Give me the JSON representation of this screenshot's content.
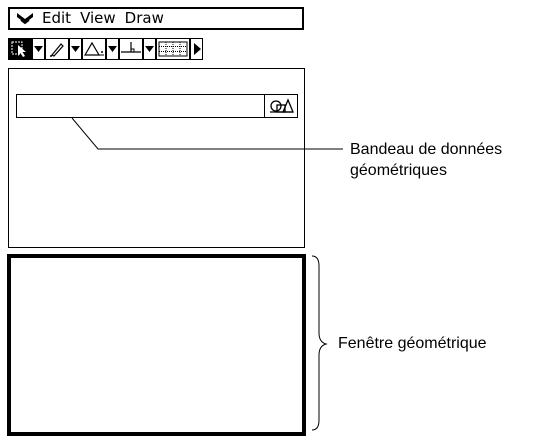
{
  "menubar": {
    "chevron_icon": "double-chevron-down-icon",
    "items": [
      {
        "label": "Edit"
      },
      {
        "label": "View"
      },
      {
        "label": "Draw"
      }
    ]
  },
  "toolbar": {
    "buttons": [
      {
        "icon": "select-pointer-icon",
        "selected": true
      },
      {
        "icon": "dropdown-arrow-icon"
      },
      {
        "icon": "pen-icon"
      },
      {
        "icon": "dropdown-arrow-icon"
      },
      {
        "icon": "triangle-icon"
      },
      {
        "icon": "dropdown-arrow-icon"
      },
      {
        "icon": "perpendicular-icon"
      },
      {
        "icon": "dropdown-arrow-icon"
      },
      {
        "icon": "grid-icon"
      },
      {
        "icon": "scroll-right-icon"
      }
    ]
  },
  "databar": {
    "value": "",
    "button_icon": "shapes-icon"
  },
  "annotations": {
    "databar_label_line1": "Bandeau de données",
    "databar_label_line2": "géométriques",
    "window_label": "Fenêtre géométrique"
  }
}
